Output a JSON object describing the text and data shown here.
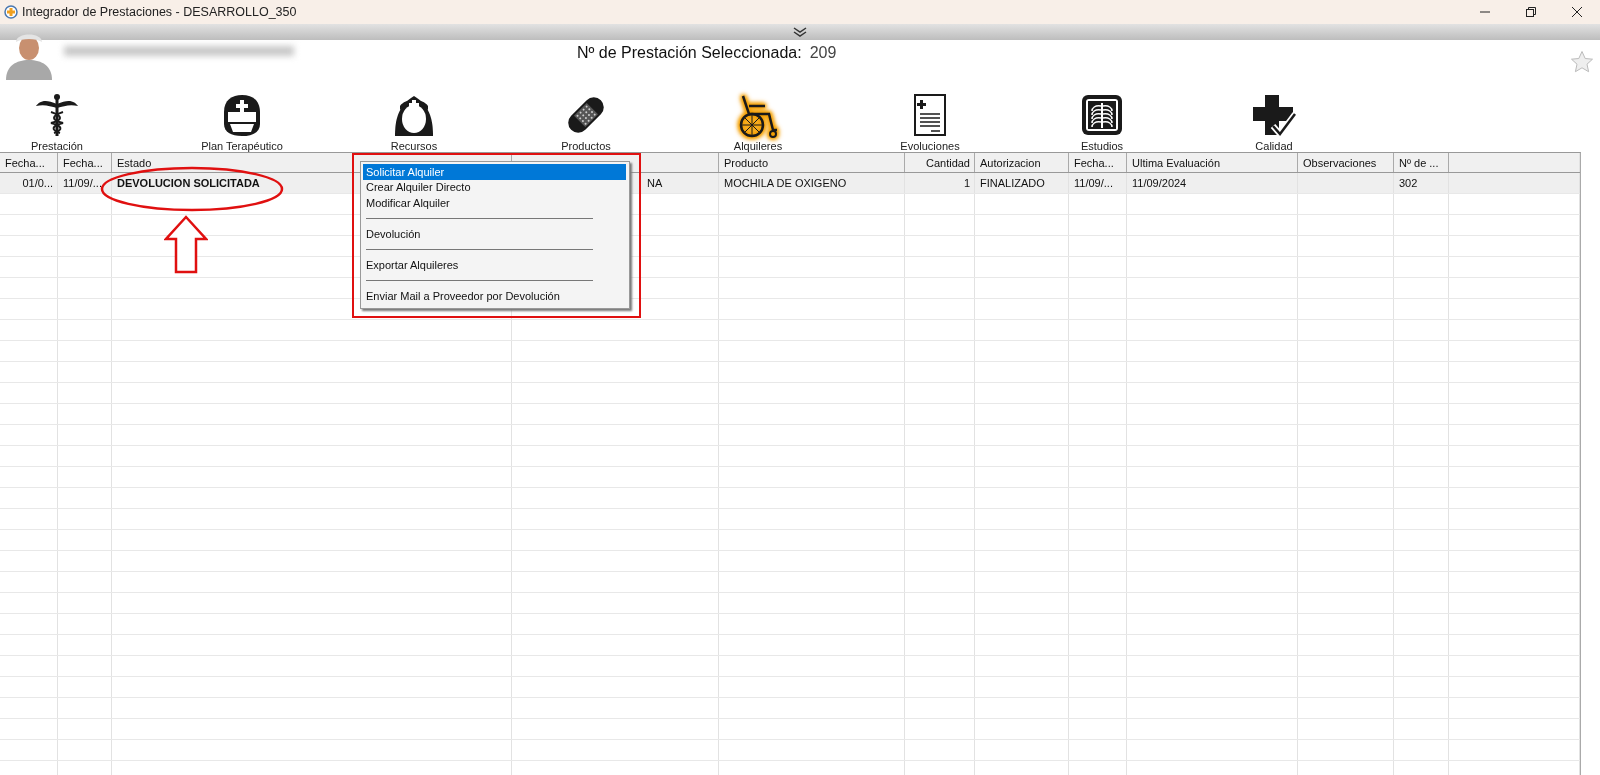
{
  "window": {
    "title": "Integrador de Prestaciones - DESARROLLO_350"
  },
  "header": {
    "label": "Nº de Prestación Seleccionada:",
    "value": "209"
  },
  "toolbar": [
    {
      "label": "Prestación",
      "selected": false
    },
    {
      "label": "Plan Terapéutico",
      "selected": false
    },
    {
      "label": "Recursos",
      "selected": false
    },
    {
      "label": "Productos",
      "selected": false
    },
    {
      "label": "Alquileres",
      "selected": true
    },
    {
      "label": "Evoluciones",
      "selected": false
    },
    {
      "label": "Estudios",
      "selected": false
    },
    {
      "label": "Calidad",
      "selected": false
    }
  ],
  "table": {
    "columns": [
      "Fecha...",
      "Fecha...",
      "Estado",
      null,
      "Producto",
      "Cantidad",
      "Autorizacion",
      "Fecha...",
      "Ultima Evaluación",
      "Observaciones",
      "Nº de ..."
    ],
    "rows": [
      {
        "selected": true,
        "cells": [
          "01/0...",
          "11/09/...",
          "DEVOLUCION SOLICITADA",
          "NA",
          "MOCHILA DE OXIGENO",
          "1",
          "FINALIZADO",
          "11/09/...",
          "11/09/2024",
          null,
          "302"
        ]
      }
    ]
  },
  "context_menu": {
    "items": [
      {
        "kind": "item",
        "label": "Solicitar Alquiler",
        "selected": true
      },
      {
        "kind": "item",
        "label": "Crear Alquiler Directo",
        "selected": false
      },
      {
        "kind": "item",
        "label": "Modificar Alquiler",
        "selected": false
      },
      {
        "kind": "separator"
      },
      {
        "kind": "item",
        "label": "Devolución",
        "selected": false
      },
      {
        "kind": "separator"
      },
      {
        "kind": "item",
        "label": "Exportar Alquileres",
        "selected": false
      },
      {
        "kind": "separator"
      },
      {
        "kind": "item",
        "label": "Enviar Mail a Proveedor por Devolución",
        "selected": false
      }
    ]
  },
  "annotations": [
    {
      "kind": "ellipse"
    },
    {
      "kind": "arrow"
    },
    {
      "kind": "rectangle"
    }
  ]
}
